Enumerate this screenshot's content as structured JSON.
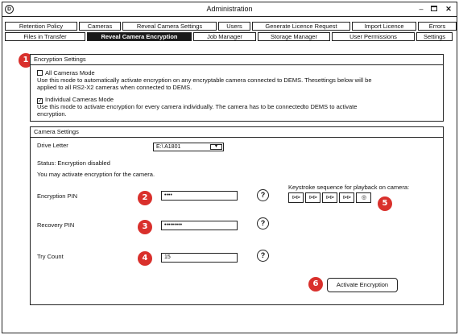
{
  "window": {
    "icon_glyph": "D",
    "title": "Administration",
    "min_glyph": "–",
    "close_glyph": "✕"
  },
  "tabs_row1": [
    "Retention Policy",
    "Cameras",
    "Reveal Camera Settings",
    "Users",
    "Generate Licence Request",
    "Import Licence",
    "Errors"
  ],
  "tabs_row2": [
    "Files in Transfer",
    "Reveal Camera Encryption",
    "Job Manager",
    "Storage Manager",
    "User Permissions",
    "Settings"
  ],
  "active_tab": "Reveal Camera Encryption",
  "encryption_settings": {
    "heading": "Encryption Settings",
    "all_mode_label": "All Cameras Mode",
    "all_mode_checked": false,
    "all_mode_desc_1": "Use this mode to automatically activate encryption on any encryptable camera connected to DEMS. Thesettings below will be",
    "all_mode_desc_2": "applied to all RS2-X2 cameras when connected to DEMS.",
    "individual_mode_label": "Individual Cameras Mode",
    "individual_mode_checked": true,
    "individual_mode_desc_1": "Use this mode to activate encryption for every camera individually. The camera has to be connectedto DEMS to activate",
    "individual_mode_desc_2": "encryption."
  },
  "camera_settings": {
    "heading": "Camera Settings",
    "drive_letter_label": "Drive Letter",
    "drive_letter_value": "E:\\ A1801",
    "status_text": "Status: Encryption disabled",
    "hint_text": "You may activate encryption for the camera.",
    "encryption_pin_label": "Encryption PIN",
    "encryption_pin_value": "••••",
    "recovery_pin_label": "Recovery PIN",
    "recovery_pin_value": "•••••••••",
    "try_count_label": "Try Count",
    "try_count_value": "15",
    "help_glyph": "?",
    "keystroke_label": "Keystroke sequence for playback on camera:",
    "keystroke_keys": [
      "⊳⊳",
      "⊳⊳",
      "⊳⊳",
      "⊳⊳",
      "◎"
    ],
    "activate_button": "Activate Encryption"
  },
  "badges": [
    "1",
    "2",
    "3",
    "4",
    "5",
    "6"
  ],
  "colors": {
    "badge": "#d9302c",
    "active_tab": "#1a1a1a"
  }
}
